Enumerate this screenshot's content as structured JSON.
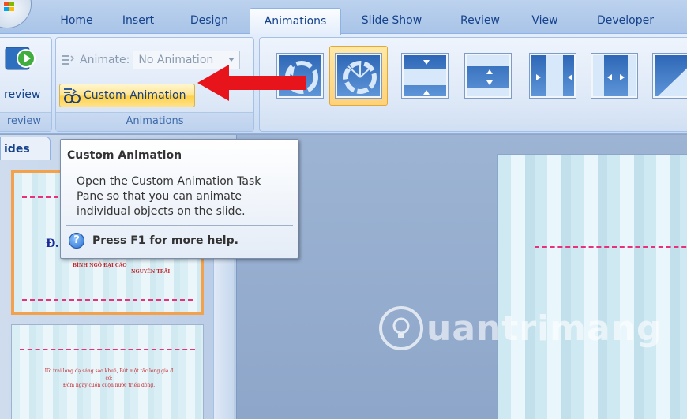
{
  "ribbon": {
    "tabs": [
      {
        "label": "Home"
      },
      {
        "label": "Insert"
      },
      {
        "label": "Design"
      },
      {
        "label": "Animations",
        "active": true
      },
      {
        "label": "Slide Show"
      },
      {
        "label": "Review"
      },
      {
        "label": "View"
      },
      {
        "label": "Developer"
      }
    ],
    "preview_group": {
      "button_label": "review",
      "group_label": "review"
    },
    "animations_group": {
      "animate_label": "Animate:",
      "animate_value": "No Animation",
      "custom_animation_label": "Custom Animation",
      "group_label": "Animations"
    },
    "transitions_gallery": {
      "items": [
        "wheel-transition",
        "wheel-transition-selected",
        "split-horizontal-in",
        "split-horizontal-out",
        "split-vertical-in",
        "split-vertical-out",
        "wipe-diagonal"
      ]
    }
  },
  "left_pane": {
    "tab_label": "ides",
    "slide1": {
      "title_fragment": "Đ.",
      "line1": "BÌNH NGÔ ĐẠI CÁO",
      "line2": "NGUYÊN TRÃI"
    },
    "slide2": {
      "line1": "Ức trai lòng đạ sáng sao khuê, Bút một tấc lòng gia đ",
      "line2": "cố;",
      "line3": "Đôm ngày cuồn cuộn nước triều đông."
    }
  },
  "tooltip": {
    "title": "Custom Animation",
    "body": "Open the Custom Animation Task Pane so that you can animate individual objects on the slide.",
    "help": "Press F1 for more help."
  },
  "watermark": {
    "text": "uantrimang"
  },
  "colors": {
    "accent_red": "#e8141b",
    "ribbon_blue": "#15428b",
    "highlight_gold": "#ffd24a",
    "dash_pink": "#e8307b"
  }
}
